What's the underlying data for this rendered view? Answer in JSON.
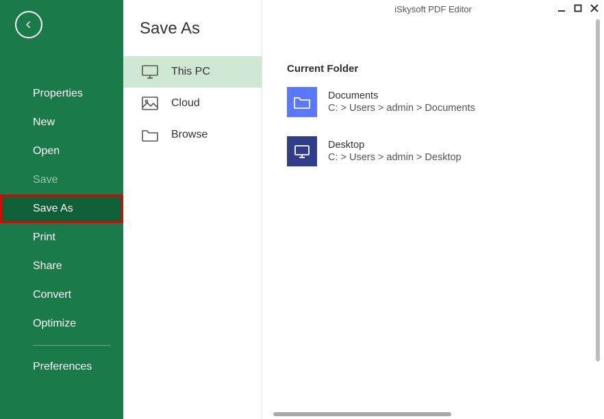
{
  "window": {
    "title": "iSkysoft PDF Editor"
  },
  "sidebar": {
    "items": [
      {
        "label": "Properties"
      },
      {
        "label": "New"
      },
      {
        "label": "Open"
      },
      {
        "label": "Save"
      },
      {
        "label": "Save As"
      },
      {
        "label": "Print"
      },
      {
        "label": "Share"
      },
      {
        "label": "Convert"
      },
      {
        "label": "Optimize"
      },
      {
        "label": "Preferences"
      }
    ]
  },
  "midpanel": {
    "title": "Save As",
    "items": [
      {
        "label": "This PC"
      },
      {
        "label": "Cloud"
      },
      {
        "label": "Browse"
      }
    ]
  },
  "content": {
    "section_title": "Current Folder",
    "folders": [
      {
        "name": "Documents",
        "path": "C: > Users > admin > Documents"
      },
      {
        "name": "Desktop",
        "path": "C: > Users > admin > Desktop"
      }
    ]
  }
}
